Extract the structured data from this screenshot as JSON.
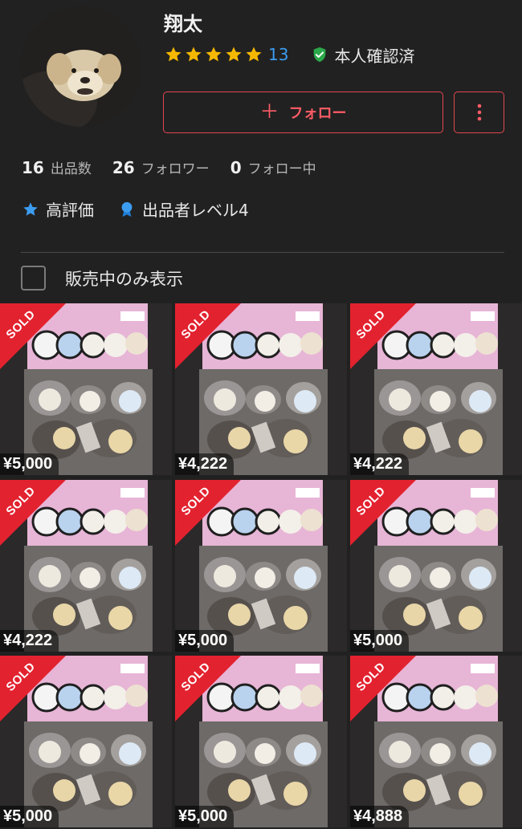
{
  "profile": {
    "username": "翔太",
    "rating_count": "13",
    "rating_stars": 5,
    "verified_label": "本人確認済",
    "follow_button": "フォロー",
    "stats": [
      {
        "num": "16",
        "label": "出品数"
      },
      {
        "num": "26",
        "label": "フォロワー"
      },
      {
        "num": "0",
        "label": "フォロー中"
      }
    ],
    "badges": [
      {
        "icon": "star-icon",
        "label": "高評価"
      },
      {
        "icon": "ribbon-medal-icon",
        "label": "出品者レベル4"
      }
    ]
  },
  "filter": {
    "label": "販売中のみ表示",
    "checked": false
  },
  "items": [
    {
      "sold": "SOLD",
      "price": "¥5,000"
    },
    {
      "sold": "SOLD",
      "price": "¥4,222"
    },
    {
      "sold": "SOLD",
      "price": "¥4,222"
    },
    {
      "sold": "SOLD",
      "price": "¥4,222"
    },
    {
      "sold": "SOLD",
      "price": "¥5,000"
    },
    {
      "sold": "SOLD",
      "price": "¥5,000"
    },
    {
      "sold": "SOLD",
      "price": "¥5,000"
    },
    {
      "sold": "SOLD",
      "price": "¥5,000"
    },
    {
      "sold": "SOLD",
      "price": "¥4,888"
    }
  ],
  "colors": {
    "background": "#212121",
    "accent_red": "#e24750",
    "sold_red": "#e3222f",
    "star_yellow": "#f5b800",
    "link_blue": "#3c9cf0",
    "verified_green": "#2aa84a"
  }
}
